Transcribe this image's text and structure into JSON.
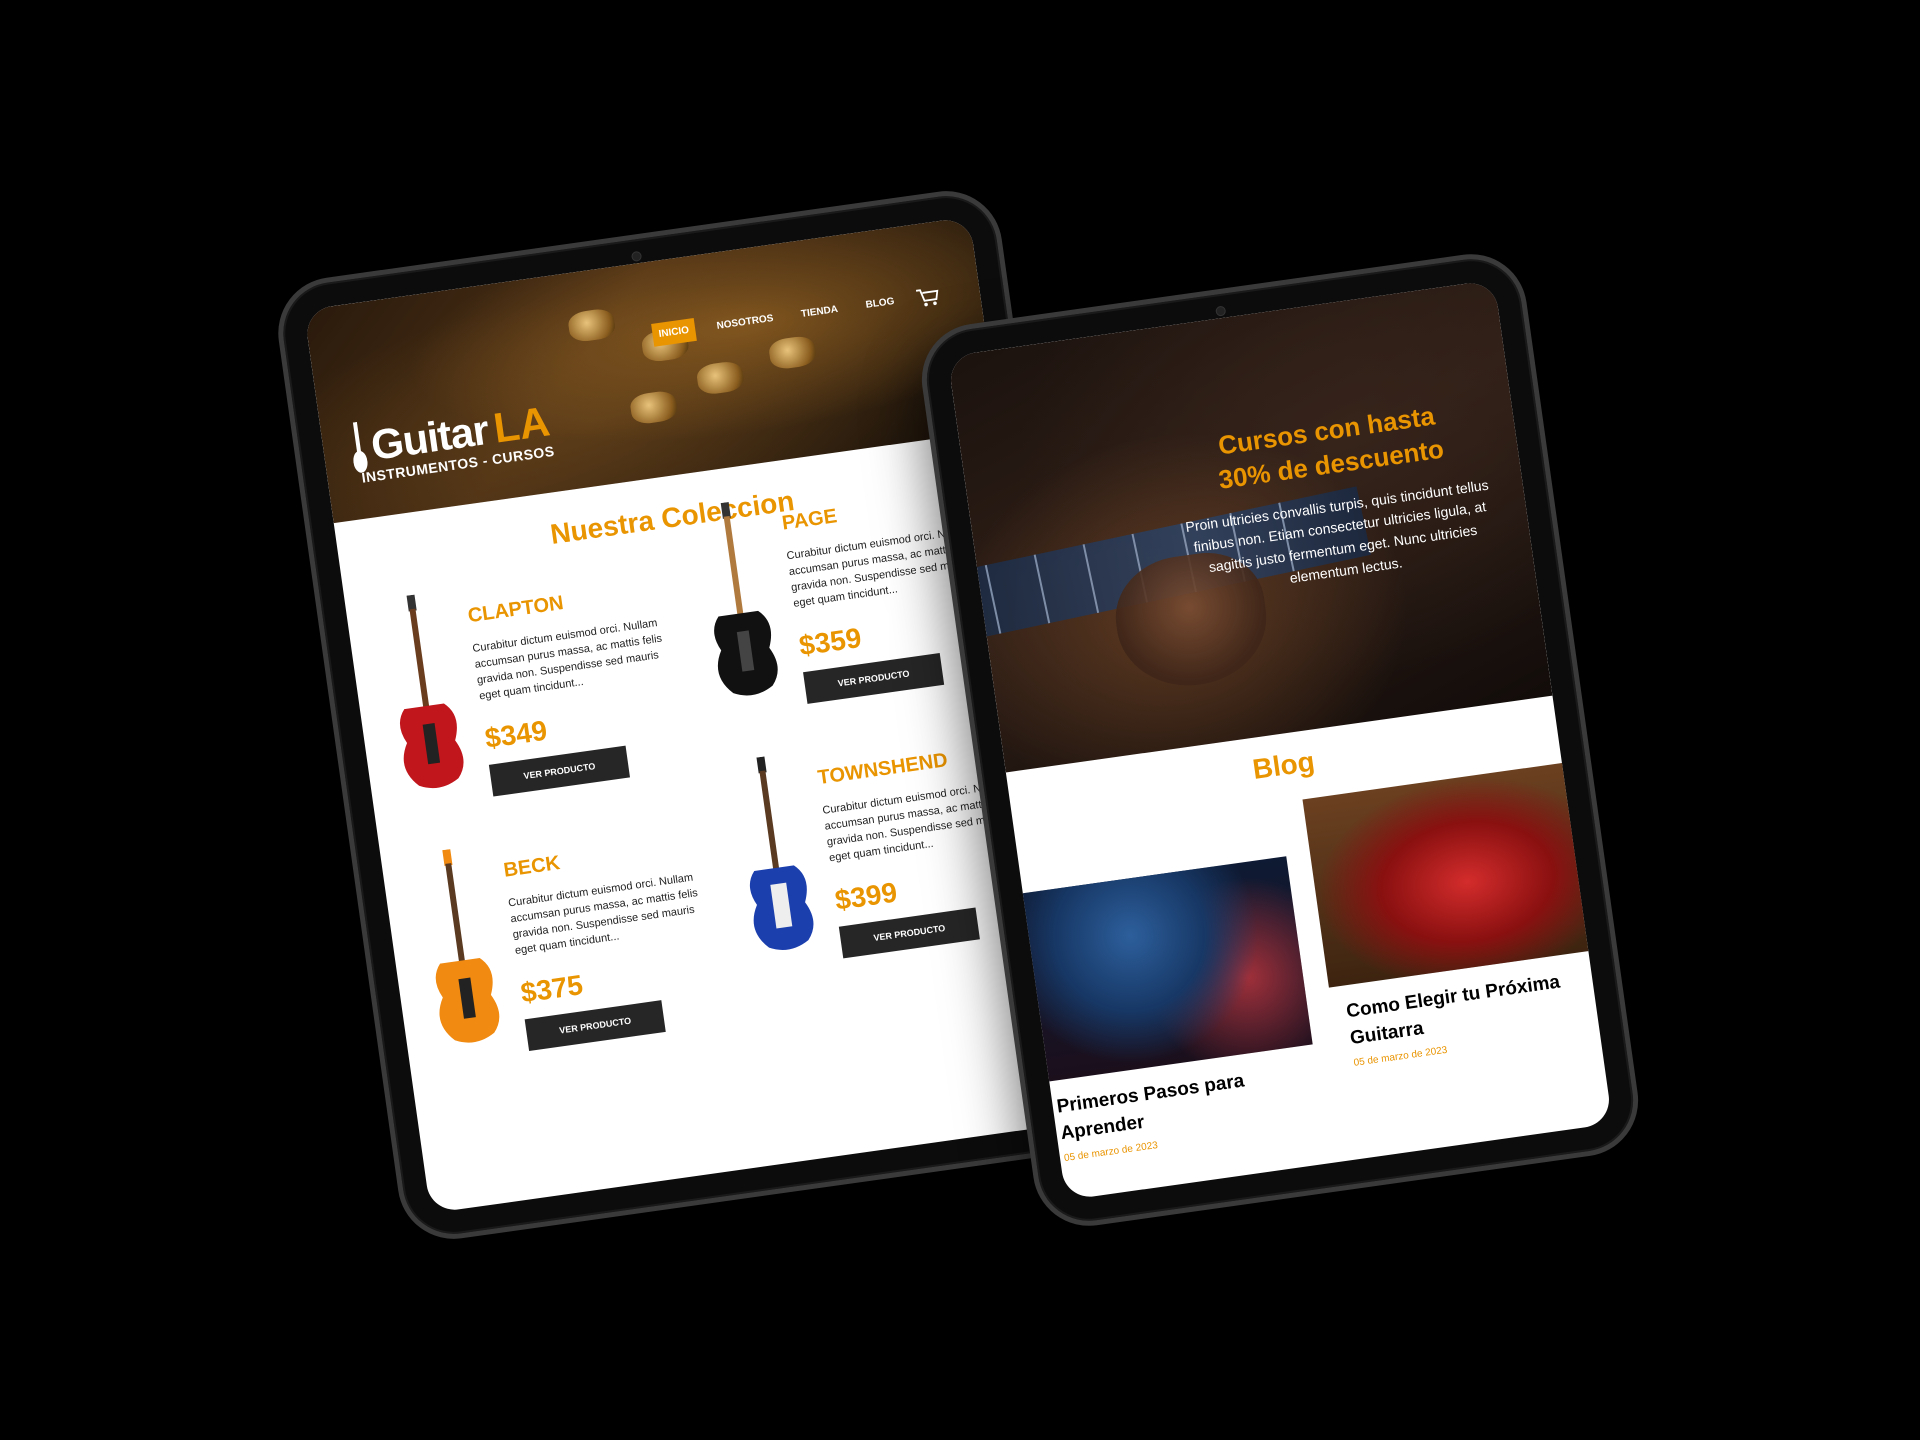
{
  "left": {
    "logo": {
      "name": "Guitar",
      "accent": "LA",
      "tagline": "INSTRUMENTOS - CURSOS"
    },
    "nav": {
      "items": [
        "INICIO",
        "NOSOTROS",
        "TIENDA",
        "BLOG"
      ],
      "active": "INICIO",
      "cart_icon": "cart-icon"
    },
    "collection_title": "Nuestra Coleccion",
    "products": [
      {
        "name": "CLAPTON",
        "description": "Curabitur dictum euismod orci. Nullam accumsan purus massa, ac mattis felis gravida non. Suspendisse sed mauris eget quam tincidunt...",
        "price": "$349",
        "button": "VER PRODUCTO",
        "guitar_color": "#c0161c"
      },
      {
        "name": "PAGE",
        "description": "Curabitur dictum euismod orci. Nullam accumsan purus massa, ac mattis felis gravida non. Suspendisse sed mauris eget quam tincidunt...",
        "price": "$359",
        "button": "VER PRODUCTO",
        "guitar_color": "#111111"
      },
      {
        "name": "BECK",
        "description": "Curabitur dictum euismod orci. Nullam accumsan purus massa, ac mattis felis gravida non. Suspendisse sed mauris eget quam tincidunt...",
        "price": "$375",
        "button": "VER PRODUCTO",
        "guitar_color": "#f08a10"
      },
      {
        "name": "TOWNSHEND",
        "description": "Curabitur dictum euismod orci. Nullam accumsan purus massa, ac mattis felis gravida non. Suspendisse sed mauris eget quam tincidunt...",
        "price": "$399",
        "button": "VER PRODUCTO",
        "guitar_color": "#1c3fae"
      }
    ]
  },
  "right": {
    "hero": {
      "title_line1": "Cursos con hasta",
      "title_line2": "30% de descuento",
      "description": "Proin ultricies convallis turpis, quis tincidunt tellus finibus non. Etiam consectetur ultricies ligula, at sagittis justo fermentum eget. Nunc ultricies elementum lectus."
    },
    "blog_title": "Blog",
    "posts": [
      {
        "title": "Primeros Pasos para Aprender",
        "date": "05 de marzo de 2023"
      },
      {
        "title": "Como Elegir tu Próxima Guitarra",
        "date": "05 de marzo de 2023"
      }
    ]
  },
  "colors": {
    "accent": "#e99401",
    "dark": "#262626",
    "background": "#000000"
  }
}
